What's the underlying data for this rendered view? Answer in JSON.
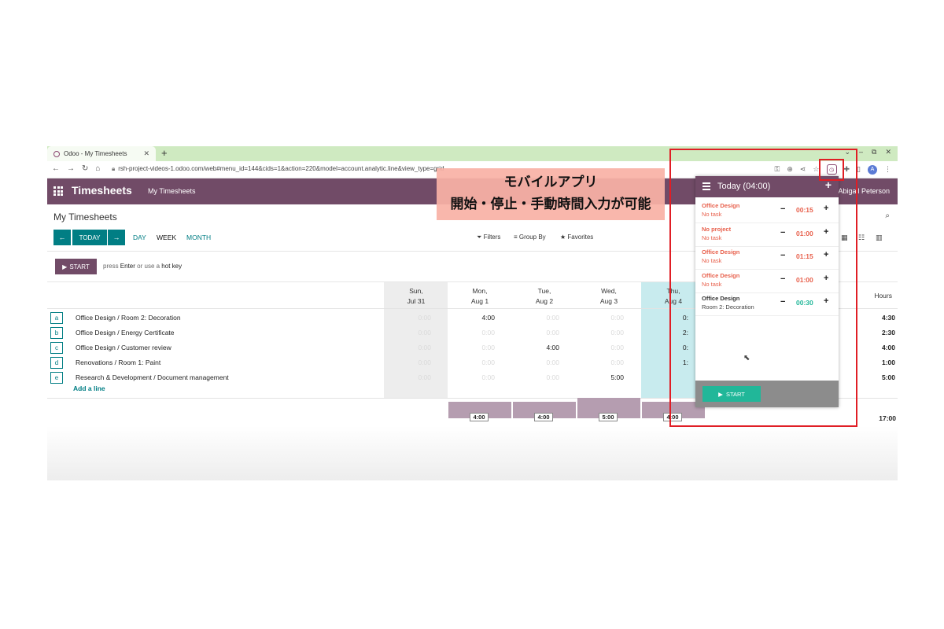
{
  "browser": {
    "tab_title": "Odoo - My Timesheets",
    "new_tab": "+",
    "window_controls": [
      "⌄",
      "–",
      "⧉",
      "✕"
    ],
    "url": "rsh-project-videos-1.odoo.com/web#menu_id=144&cids=1&action=220&model=account.analytic.line&view_type=grid",
    "avatar_letter": "A"
  },
  "navbar": {
    "app_name": "Timesheets",
    "menu_item": "My Timesheets",
    "user": "Abigail Peterson"
  },
  "control_panel": {
    "title": "My Timesheets",
    "today_button": "TODAY",
    "prev": "←",
    "next": "→",
    "ranges": [
      "DAY",
      "WEEK",
      "MONTH"
    ],
    "active_range": "WEEK",
    "filters": "Filters",
    "group_by": "Group By",
    "favorites": "Favorites"
  },
  "start_row": {
    "start_label": "START",
    "hint_prefix": "press",
    "hint_key": "Enter",
    "hint_mid": "or use a",
    "hint_suffix": "hot key"
  },
  "grid": {
    "days": [
      {
        "name": "Sun,",
        "date": "Jul 31"
      },
      {
        "name": "Mon,",
        "date": "Aug 1"
      },
      {
        "name": "Tue,",
        "date": "Aug 2"
      },
      {
        "name": "Wed,",
        "date": "Aug 3"
      },
      {
        "name": "Thu,",
        "date": "Aug 4"
      }
    ],
    "hours_header": "Hours",
    "rows": [
      {
        "key": "a",
        "label": "Office Design / Room 2: Decoration",
        "cells": [
          "0:00",
          "4:00",
          "0:00",
          "0:00",
          "0:"
        ],
        "total": "4:30"
      },
      {
        "key": "b",
        "label": "Office Design / Energy Certificate",
        "cells": [
          "0:00",
          "0:00",
          "0:00",
          "0:00",
          "2:"
        ],
        "total": "2:30"
      },
      {
        "key": "c",
        "label": "Office Design / Customer review",
        "cells": [
          "0:00",
          "0:00",
          "4:00",
          "0:00",
          "0:"
        ],
        "total": "4:00"
      },
      {
        "key": "d",
        "label": "Renovations / Room 1: Paint",
        "cells": [
          "0:00",
          "0:00",
          "0:00",
          "0:00",
          "1:"
        ],
        "total": "1:00"
      },
      {
        "key": "e",
        "label": "Research & Development / Document management",
        "cells": [
          "0:00",
          "0:00",
          "0:00",
          "5:00",
          ""
        ],
        "total": "5:00"
      }
    ],
    "add_line": "Add a line",
    "day_totals": [
      "",
      "4:00",
      "4:00",
      "5:00",
      "4:00"
    ],
    "day_total_levels": [
      0,
      4,
      4,
      5,
      4
    ],
    "grand_total": "17:00"
  },
  "timer": {
    "header": "Today (04:00)",
    "add": "+",
    "entries": [
      {
        "project": "Office Design",
        "task": "No task",
        "time": "00:15",
        "running": false
      },
      {
        "project": "No project",
        "task": "No task",
        "time": "01:00",
        "running": false
      },
      {
        "project": "Office Design",
        "task": "No task",
        "time": "01:15",
        "running": false
      },
      {
        "project": "Office Design",
        "task": "No task",
        "time": "01:00",
        "running": false
      },
      {
        "project": "Office Design",
        "task": "Room 2: Decoration",
        "time": "00:30",
        "running": true
      }
    ],
    "minus": "−",
    "plus": "+",
    "start_label": "START"
  },
  "callout": {
    "line1": "モバイルアプリ",
    "line2": "開始・停止・手動時間入力が可能"
  },
  "colors": {
    "brand": "#714b67",
    "teal": "#017e84",
    "running": "#21b799",
    "stopped": "#e8604c",
    "highlight": "#e01e25"
  }
}
